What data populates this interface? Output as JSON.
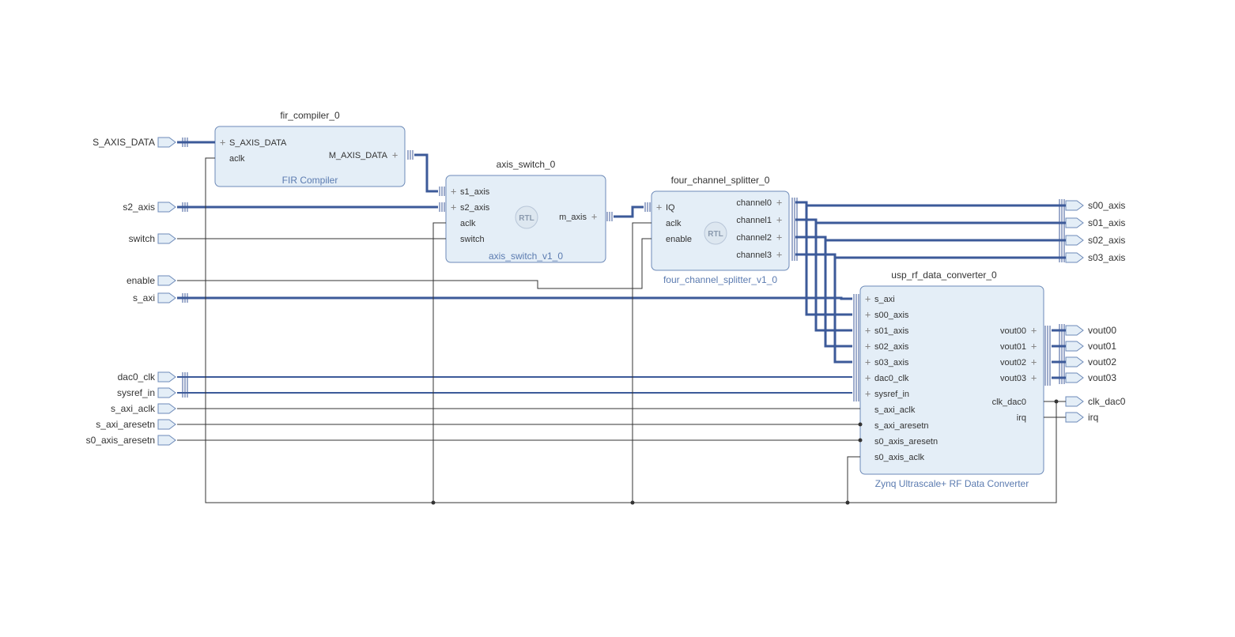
{
  "extLeft": [
    {
      "k": "sadata",
      "t": "S_AXIS_DATA"
    },
    {
      "k": "s2",
      "t": "s2_axis"
    },
    {
      "k": "sw",
      "t": "switch"
    },
    {
      "k": "en",
      "t": "enable"
    },
    {
      "k": "saxi",
      "t": "s_axi"
    },
    {
      "k": "d0",
      "t": "dac0_clk"
    },
    {
      "k": "sref",
      "t": "sysref_in"
    },
    {
      "k": "saclk",
      "t": "s_axi_aclk"
    },
    {
      "k": "sarn",
      "t": "s_axi_aresetn"
    },
    {
      "k": "s0rn",
      "t": "s0_axis_aresetn"
    }
  ],
  "extRight": [
    {
      "k": "s00",
      "t": "s00_axis"
    },
    {
      "k": "s01",
      "t": "s01_axis"
    },
    {
      "k": "s02",
      "t": "s02_axis"
    },
    {
      "k": "s03",
      "t": "s03_axis"
    },
    {
      "k": "v00",
      "t": "vout00"
    },
    {
      "k": "v01",
      "t": "vout01"
    },
    {
      "k": "v02",
      "t": "vout02"
    },
    {
      "k": "v03",
      "t": "vout03"
    },
    {
      "k": "ckd",
      "t": "clk_dac0"
    },
    {
      "k": "irq",
      "t": "irq"
    }
  ],
  "fir": {
    "inst": "fir_compiler_0",
    "type": "FIR Compiler",
    "pin": [
      {
        "k": "sa",
        "t": "S_AXIS_DATA"
      },
      {
        "k": "aclk",
        "t": "aclk"
      }
    ],
    "pout": [
      {
        "k": "ma",
        "t": "M_AXIS_DATA"
      }
    ]
  },
  "sw": {
    "inst": "axis_switch_0",
    "type": "axis_switch_v1_0",
    "pin": [
      {
        "k": "s1",
        "t": "s1_axis"
      },
      {
        "k": "s2",
        "t": "s2_axis"
      },
      {
        "k": "aclk",
        "t": "aclk"
      },
      {
        "k": "sw",
        "t": "switch"
      }
    ],
    "pout": [
      {
        "k": "m",
        "t": "m_axis"
      }
    ]
  },
  "sp": {
    "inst": "four_channel_splitter_0",
    "type": "four_channel_splitter_v1_0",
    "pin": [
      {
        "k": "iq",
        "t": "IQ"
      },
      {
        "k": "aclk",
        "t": "aclk"
      },
      {
        "k": "en",
        "t": "enable"
      }
    ],
    "pout": [
      {
        "k": "c0",
        "t": "channel0"
      },
      {
        "k": "c1",
        "t": "channel1"
      },
      {
        "k": "c2",
        "t": "channel2"
      },
      {
        "k": "c3",
        "t": "channel3"
      }
    ]
  },
  "rf": {
    "inst": "usp_rf_data_converter_0",
    "type": "Zynq Ultrascale+ RF Data Converter",
    "pin": [
      {
        "k": "sa",
        "t": "s_axi"
      },
      {
        "k": "s00",
        "t": "s00_axis"
      },
      {
        "k": "s01",
        "t": "s01_axis"
      },
      {
        "k": "s02",
        "t": "s02_axis"
      },
      {
        "k": "s03",
        "t": "s03_axis"
      },
      {
        "k": "d0",
        "t": "dac0_clk"
      },
      {
        "k": "sr",
        "t": "sysref_in"
      },
      {
        "k": "sac",
        "t": "s_axi_aclk"
      },
      {
        "k": "sar",
        "t": "s_axi_aresetn"
      },
      {
        "k": "s0r",
        "t": "s0_axis_aresetn"
      },
      {
        "k": "s0c",
        "t": "s0_axis_aclk"
      }
    ],
    "pout": [
      {
        "k": "v0",
        "t": "vout00"
      },
      {
        "k": "v1",
        "t": "vout01"
      },
      {
        "k": "v2",
        "t": "vout02"
      },
      {
        "k": "v3",
        "t": "vout03"
      },
      {
        "k": "cd",
        "t": "clk_dac0"
      },
      {
        "k": "irq",
        "t": "irq"
      }
    ]
  }
}
